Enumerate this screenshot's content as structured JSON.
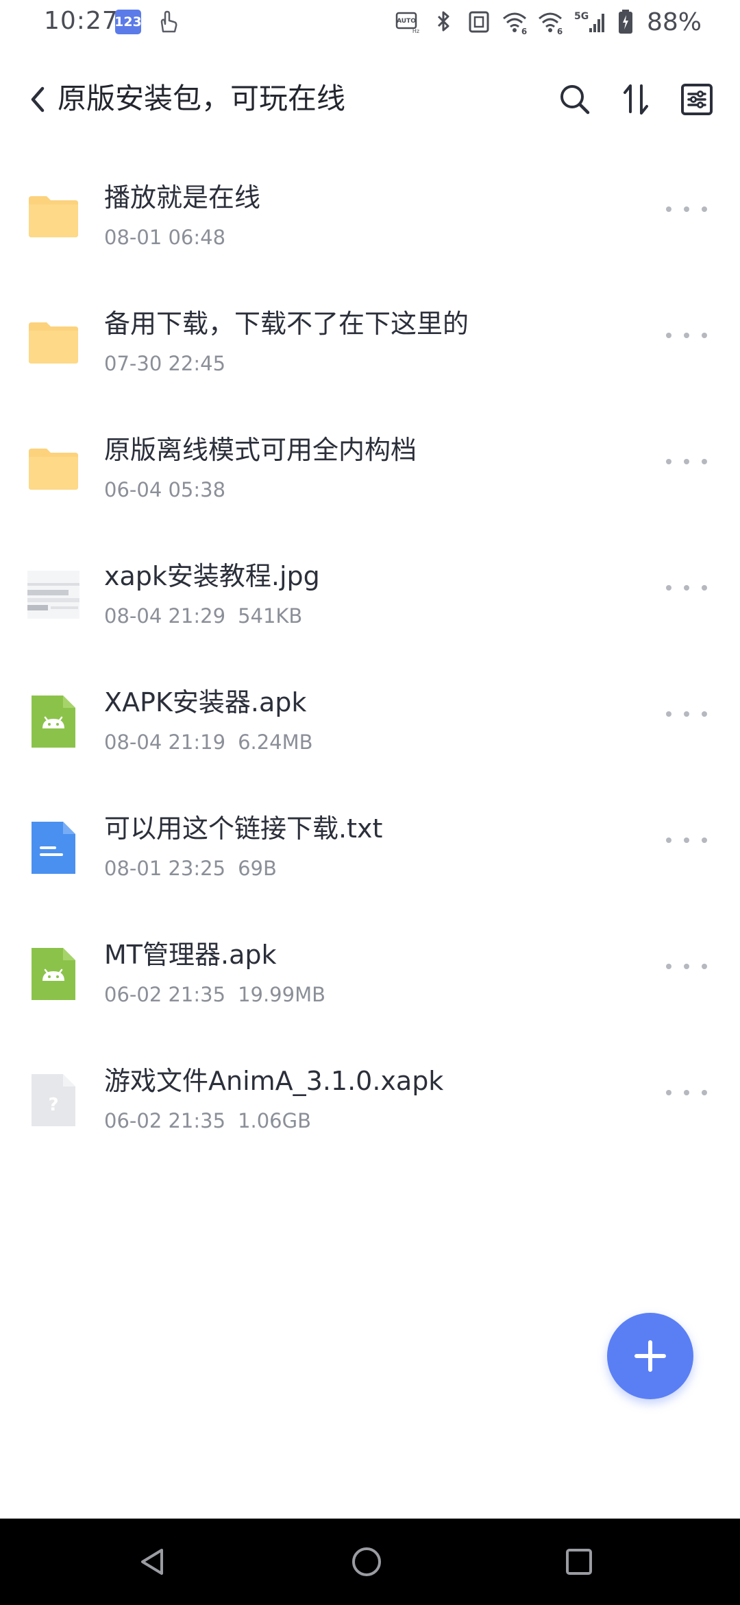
{
  "status_bar": {
    "time": "10:27",
    "badge": "123",
    "battery_percent": "88%",
    "network": "5G",
    "wifi_badge": "6",
    "icons": [
      "hand-icon",
      "auto-hz-icon",
      "bluetooth-icon",
      "nfc-icon",
      "wifi6-icon",
      "wifi6-icon",
      "5g-signal-icon",
      "battery-icon"
    ]
  },
  "header": {
    "title": "原版安装包，可玩在线",
    "back_icon": "chevron-left-icon",
    "search_icon": "search-icon",
    "sort_icon": "sort-icon",
    "options_icon": "settings-sliders-icon"
  },
  "files": [
    {
      "name": "播放就是在线",
      "date": "08-01 06:48",
      "size": "",
      "type": "folder"
    },
    {
      "name": "备用下载，下载不了在下这里的",
      "date": "07-30 22:45",
      "size": "",
      "type": "folder"
    },
    {
      "name": "原版离线模式可用全内构档",
      "date": "06-04 05:38",
      "size": "",
      "type": "folder"
    },
    {
      "name": "xapk安装教程.jpg",
      "date": "08-04 21:29",
      "size": "541KB",
      "type": "image"
    },
    {
      "name": "XAPK安装器.apk",
      "date": "08-04 21:19",
      "size": "6.24MB",
      "type": "apk"
    },
    {
      "name": "可以用这个链接下载.txt",
      "date": "08-01 23:25",
      "size": "69B",
      "type": "text"
    },
    {
      "name": "MT管理器.apk",
      "date": "06-02 21:35",
      "size": "19.99MB",
      "type": "apk"
    },
    {
      "name": "游戏文件AnimA_3.1.0.xapk",
      "date": "06-02 21:35",
      "size": "1.06GB",
      "type": "unknown"
    }
  ],
  "fab": {
    "icon": "plus-icon"
  },
  "colors": {
    "accent": "#5a7ff5",
    "folder": "#fcd27d",
    "apk": "#8bc34a",
    "text_file": "#4a90f0",
    "unknown": "#e6e7ea",
    "meta_text": "#8b8f98"
  },
  "nav_bar": {
    "back_icon": "triangle-back-icon",
    "home_icon": "circle-home-icon",
    "recents_icon": "square-recents-icon"
  }
}
